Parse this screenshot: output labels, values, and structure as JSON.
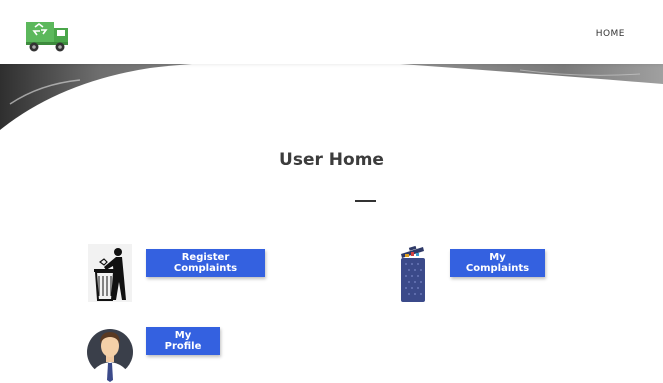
{
  "nav": {
    "home_label": "HOME"
  },
  "page": {
    "title": "User Home"
  },
  "actions": {
    "register_complaints": "Register Complaints",
    "my_complaints": "My Complaints",
    "my_profile": "My Profile"
  },
  "colors": {
    "button_blue": "#3461e0",
    "title_gray": "#3c3c3c",
    "truck_green": "#5cb85c"
  },
  "icons": {
    "logo": "garbage-truck-recycle-icon",
    "register": "person-throwing-trash-icon",
    "complaints": "trash-bin-icon",
    "profile": "user-avatar-icon"
  }
}
